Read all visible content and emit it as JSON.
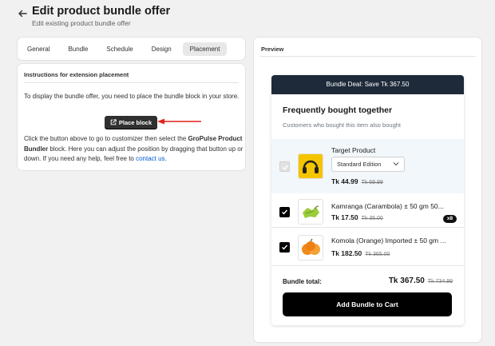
{
  "header": {
    "title": "Edit product bundle offer",
    "subtitle": "Edit existing product bundle offer"
  },
  "tabs": [
    {
      "label": "General",
      "active": false
    },
    {
      "label": "Bundle",
      "active": false
    },
    {
      "label": "Schedule",
      "active": false
    },
    {
      "label": "Design",
      "active": false
    },
    {
      "label": "Placement",
      "active": true
    }
  ],
  "instructions": {
    "title": "Instructions for extension placement",
    "paragraph1": "To display the bundle offer, you need to place the bundle block in your store.",
    "button_label": "Place block",
    "p2_before": "Click the button above to go to customizer then select the ",
    "p2_bold": "GroPulse Product Bundler",
    "p2_after": " block. Here you can adjust the position by dragging that button up or down. If you need any help, feel free to ",
    "contact_link": "contact us",
    "p2_end": "."
  },
  "preview": {
    "label": "Preview",
    "banner": "Bundle Deal: Save Tk 367.50",
    "title": "Frequently bought together",
    "subtitle": "Customers who bought this item also bought",
    "products": [
      {
        "name": "Target Product",
        "variant": "Standard Edition",
        "price": "Tk 44.99",
        "compare": "Tk 69.99",
        "checked": true,
        "disabled": true,
        "icon": "headphones-icon"
      },
      {
        "name": "Kamranga (Carambola) ± 50 gm 50...",
        "price": "Tk 17.50",
        "compare": "Tk 35.00",
        "checked": true,
        "qty": "x8",
        "icon": "carambola-icon"
      },
      {
        "name": "Komola (Orange) Imported ± 50 gm ...",
        "price": "Tk 182.50",
        "compare": "Tk 365.00",
        "checked": true,
        "icon": "orange-icon"
      }
    ],
    "total_label": "Bundle total:",
    "total_price": "Tk 367.50",
    "total_compare": "Tk 734.99",
    "cta": "Add Bundle to Cart"
  },
  "colors": {
    "banner": "#1e2a3a",
    "link": "#005bd3",
    "annotation_arrow": "#e0201c",
    "button_dark": "#303030"
  }
}
